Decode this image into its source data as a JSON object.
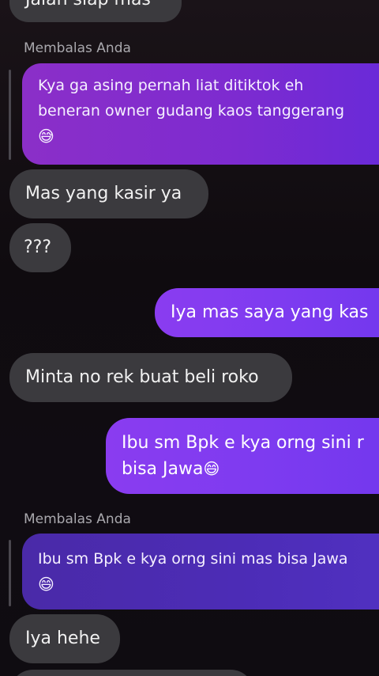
{
  "messages": {
    "m0": "Jalan siap mas",
    "reply1_label": "Membalas Anda",
    "quote1_line1": "Kya ga asing pernah liat ditiktok eh",
    "quote1_line2": "beneran owner gudang kaos tanggerang",
    "quote1_emoji": "😅",
    "m1": "Mas yang kasir ya",
    "m2": "???",
    "m3": "Iya mas saya yang kas",
    "m4": "Minta no rek buat beli roko",
    "m5_line1": "Ibu sm Bpk e kya orng sini r",
    "m5_line2": "bisa Jawa",
    "m5_emoji": "😄",
    "reply2_label": "Membalas Anda",
    "quote2_line1": "Ibu sm Bpk e kya orng sini mas bisa Jawa",
    "quote2_emoji": "😄",
    "m6": "Iya hehe"
  },
  "colors": {
    "received_bubble": "#3b3a3e",
    "sent_bubble": "#8a3cf0",
    "quote_bubble_top": "#9a2fd6",
    "quote_bubble_bottom": "#4a2fb8"
  }
}
